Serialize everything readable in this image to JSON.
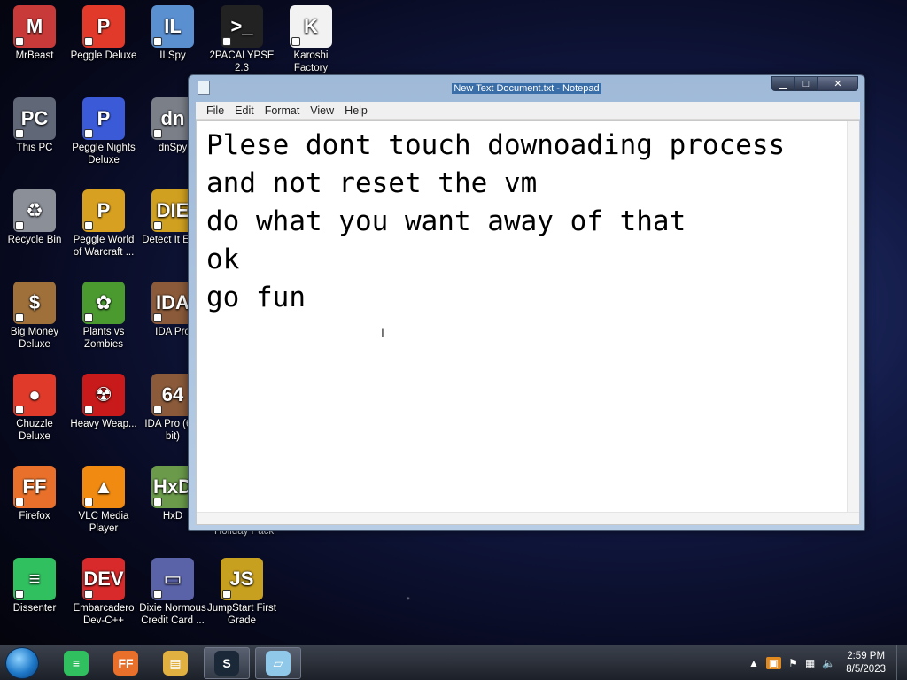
{
  "desktop": {
    "icons": [
      {
        "label": "MrBeast",
        "icon": "mrbeast-icon",
        "color": "#c83a3a",
        "glyph": "M"
      },
      {
        "label": "Peggle Deluxe",
        "icon": "peggle-icon",
        "color": "#e23a2a",
        "glyph": "P"
      },
      {
        "label": "ILSpy",
        "icon": "ilspy-icon",
        "color": "#5a8fd0",
        "glyph": "IL"
      },
      {
        "label": "2PACALYPSE 2.3",
        "icon": "console-icon",
        "color": "#222222",
        "glyph": ">_"
      },
      {
        "label": "Karoshi Factory",
        "icon": "karoshi-icon",
        "color": "#f2f2f2",
        "glyph": "K"
      },
      {
        "label": "This PC",
        "icon": "computer-icon",
        "color": "#606878",
        "glyph": "PC"
      },
      {
        "label": "Peggle Nights Deluxe",
        "icon": "peggle-nights-icon",
        "color": "#3a5ad8",
        "glyph": "P"
      },
      {
        "label": "dnSpy",
        "icon": "dnspy-icon",
        "color": "#7a7f88",
        "glyph": "dn"
      },
      {
        "label": "Recycle Bin",
        "icon": "recycle-bin-icon",
        "color": "#8a8f98",
        "glyph": "♻"
      },
      {
        "label": "Peggle World of Warcraft ...",
        "icon": "peggle-wow-icon",
        "color": "#d8a020",
        "glyph": "P"
      },
      {
        "label": "Detect It Ea...",
        "icon": "detect-it-easy-icon",
        "color": "#d0a020",
        "glyph": "DIE"
      },
      {
        "label": "Big Money Deluxe",
        "icon": "money-bag-icon",
        "color": "#a0703a",
        "glyph": "$"
      },
      {
        "label": "Plants vs Zombies",
        "icon": "plants-zombies-icon",
        "color": "#4a9a30",
        "glyph": "✿"
      },
      {
        "label": "IDA Pro",
        "icon": "ida-pro-icon",
        "color": "#8a5a3a",
        "glyph": "IDA"
      },
      {
        "label": "Chuzzle Deluxe",
        "icon": "chuzzle-icon",
        "color": "#e03a2a",
        "glyph": "●"
      },
      {
        "label": "Heavy Weap...",
        "icon": "heavy-weapon-icon",
        "color": "#c81a1a",
        "glyph": "☢"
      },
      {
        "label": "IDA Pro (64-bit)",
        "icon": "ida-pro-64-icon",
        "color": "#8a5a3a",
        "glyph": "64"
      },
      {
        "label": "Firefox",
        "icon": "firefox-icon",
        "color": "#e8702a",
        "glyph": "FF"
      },
      {
        "label": "VLC Media Player",
        "icon": "vlc-icon",
        "color": "#f08a10",
        "glyph": "▲"
      },
      {
        "label": "HxD",
        "icon": "hxd-icon",
        "color": "#6a9a4a",
        "glyph": "HxD"
      },
      {
        "label": "Dissenter",
        "icon": "dissenter-icon",
        "color": "#30c060",
        "glyph": "≡"
      },
      {
        "label": "Embarcadero Dev-C++",
        "icon": "devcpp-icon",
        "color": "#d82a2a",
        "glyph": "DEV"
      },
      {
        "label": "Dixie Normous Credit Card ...",
        "icon": "credit-card-icon",
        "color": "#5a62a8",
        "glyph": "▭"
      },
      {
        "label": "JumpStart First Grade",
        "icon": "jumpstart-icon",
        "color": "#c8a020",
        "glyph": "JS"
      }
    ],
    "hidden_label": "Holiday Pack"
  },
  "notepad": {
    "title": "New Text Document.txt - Notepad",
    "menu": [
      "File",
      "Edit",
      "Format",
      "View",
      "Help"
    ],
    "content": "Plese dont touch downoading process\nand not reset the vm\ndo what you want away of that\nok\ngo fun"
  },
  "taskbar": {
    "apps": [
      {
        "icon": "dissenter-icon",
        "color": "#30c060",
        "glyph": "≡"
      },
      {
        "icon": "firefox-icon",
        "color": "#e8702a",
        "glyph": "FF"
      },
      {
        "icon": "file-explorer-icon",
        "color": "#e0b040",
        "glyph": "▤"
      },
      {
        "icon": "steam-icon",
        "color": "#1b2838",
        "glyph": "S"
      },
      {
        "icon": "notepad-icon",
        "color": "#8fc8e8",
        "glyph": "▱"
      }
    ],
    "tray": {
      "time": "2:59 PM",
      "date": "8/5/2023"
    }
  }
}
